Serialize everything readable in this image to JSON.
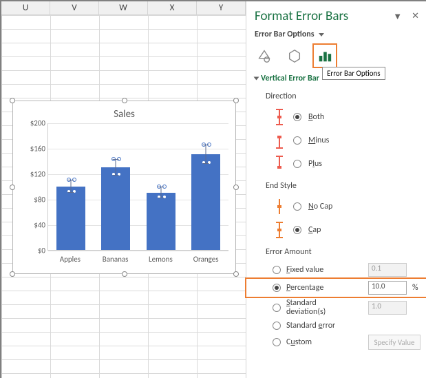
{
  "columns": [
    "U",
    "V",
    "W",
    "X",
    "Y"
  ],
  "pane": {
    "title": "Format Error Bars",
    "subtitle": "Error Bar Options",
    "tooltip": "Error Bar Options",
    "section": "Vertical Error Bar",
    "direction_label": "Direction",
    "direction": {
      "both": "Both",
      "minus": "Minus",
      "plus": "Plus",
      "selected": "both"
    },
    "endstyle_label": "End Style",
    "endstyle": {
      "nocap": "No Cap",
      "cap": "Cap",
      "selected": "cap"
    },
    "amount_label": "Error Amount",
    "amount": {
      "fixed_label": "Fixed value",
      "fixed_value": "0.1",
      "percentage_label": "Percentage",
      "percentage_value": "10.0",
      "percentage_unit": "%",
      "stddev_label": "Standard deviation(s)",
      "stddev_value": "1.0",
      "stderr_label": "Standard error",
      "custom_label": "Custom",
      "custom_button": "Specify Value",
      "selected": "percentage"
    }
  },
  "chart_data": {
    "type": "bar",
    "title": "Sales",
    "categories": [
      "Apples",
      "Bananas",
      "Lemons",
      "Oranges"
    ],
    "values": [
      100,
      130,
      90,
      150
    ],
    "error_percentage": 10.0,
    "ylabel_format": "$",
    "yticks": [
      0,
      40,
      80,
      120,
      160,
      200
    ],
    "ylim": [
      0,
      200
    ],
    "ytick_labels": [
      "$0",
      "$40",
      "$80",
      "$120",
      "$160",
      "$200"
    ],
    "error_bars": {
      "direction": "both",
      "cap": true
    }
  }
}
